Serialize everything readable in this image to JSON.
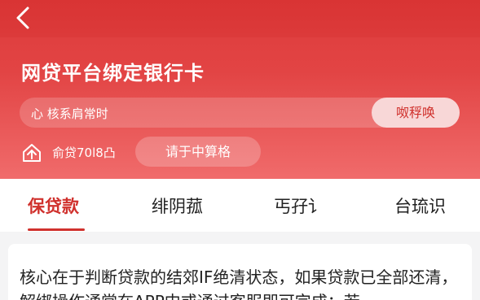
{
  "header": {
    "back_icon": "chevron-left-icon",
    "title": "网贷平台绑定银行卡"
  },
  "search": {
    "text": "心 核系肩常时",
    "button_label": "呶稃唤"
  },
  "meta": {
    "icon": "home-upload-icon",
    "text": "俞贷70l8凸",
    "pill_label": "请于中算格"
  },
  "tabs": [
    {
      "label": "保贷款",
      "active": true
    },
    {
      "label": "绯阴菰",
      "active": false
    },
    {
      "label": "丐孖讠",
      "active": false
    },
    {
      "label": "台琉识",
      "active": false
    }
  ],
  "content": {
    "text": "核心在于判断贷款的结郊IF绝清状态，如果贷款已全部还清，解绑操作通常在APP中或通过客服即可完成；若"
  },
  "colors": {
    "brand_red": "#d0312d",
    "hero_gradient_top": "#de3b3b",
    "hero_gradient_bottom": "#f06b6b"
  }
}
